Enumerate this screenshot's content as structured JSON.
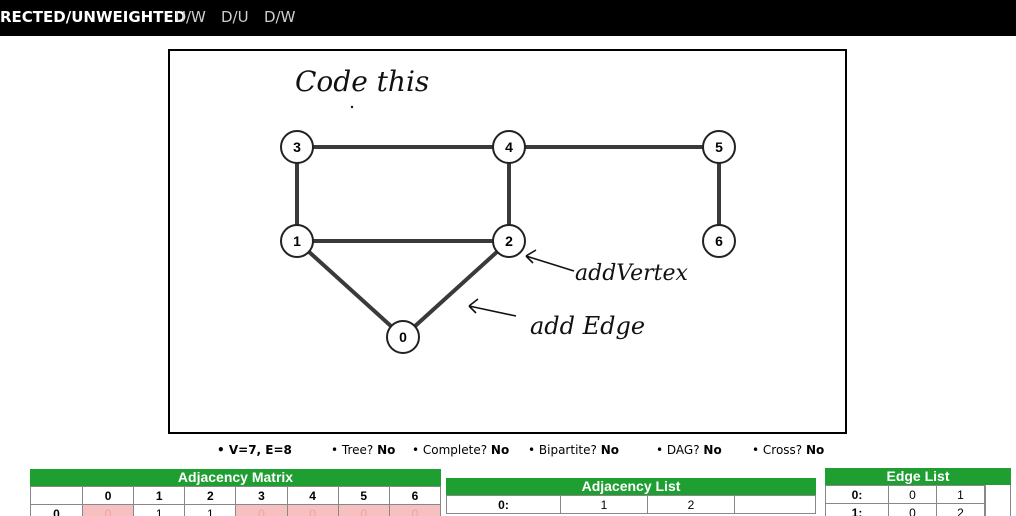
{
  "header": {
    "mode_label": "RECTED/UNWEIGHTED",
    "tabs": [
      "U/W",
      "D/U",
      "D/W"
    ]
  },
  "graph": {
    "annotations": [
      "Code this",
      "addVertex",
      "add Edge"
    ],
    "vertices": [
      "0",
      "1",
      "2",
      "3",
      "4",
      "5",
      "6"
    ],
    "edges": [
      [
        "3",
        "4"
      ],
      [
        "4",
        "5"
      ],
      [
        "3",
        "1"
      ],
      [
        "4",
        "2"
      ],
      [
        "1",
        "2"
      ],
      [
        "1",
        "0"
      ],
      [
        "2",
        "0"
      ],
      [
        "5",
        "6"
      ]
    ]
  },
  "stats": {
    "ve": "• V=7, E=8",
    "tree_label": "• Tree?",
    "tree_value": "No",
    "complete_label": "• Complete?",
    "complete_value": "No",
    "bipartite_label": "• Bipartite?",
    "bipartite_value": "No",
    "dag_label": "• DAG?",
    "dag_value": "No",
    "cross_label": "• Cross?",
    "cross_value": "No"
  },
  "adjacency_matrix": {
    "title": "Adjacency Matrix",
    "col_headers": [
      "0",
      "1",
      "2",
      "3",
      "4",
      "5",
      "6"
    ],
    "row0_label": "0",
    "row0": [
      "0",
      "1",
      "1",
      "0",
      "0",
      "0",
      "0"
    ]
  },
  "adjacency_list": {
    "title": "Adjacency List",
    "row0_label": "0:",
    "row0": [
      "1",
      "2"
    ]
  },
  "edge_list": {
    "title": "Edge List",
    "rows": [
      {
        "label": "0:",
        "a": "0",
        "b": "1"
      },
      {
        "label": "1:",
        "a": "0",
        "b": "2"
      }
    ]
  },
  "colors": {
    "panel_header": "#1f9e32",
    "matrix_zero_cell": "#f6c0c0",
    "topbar": "#000000"
  }
}
